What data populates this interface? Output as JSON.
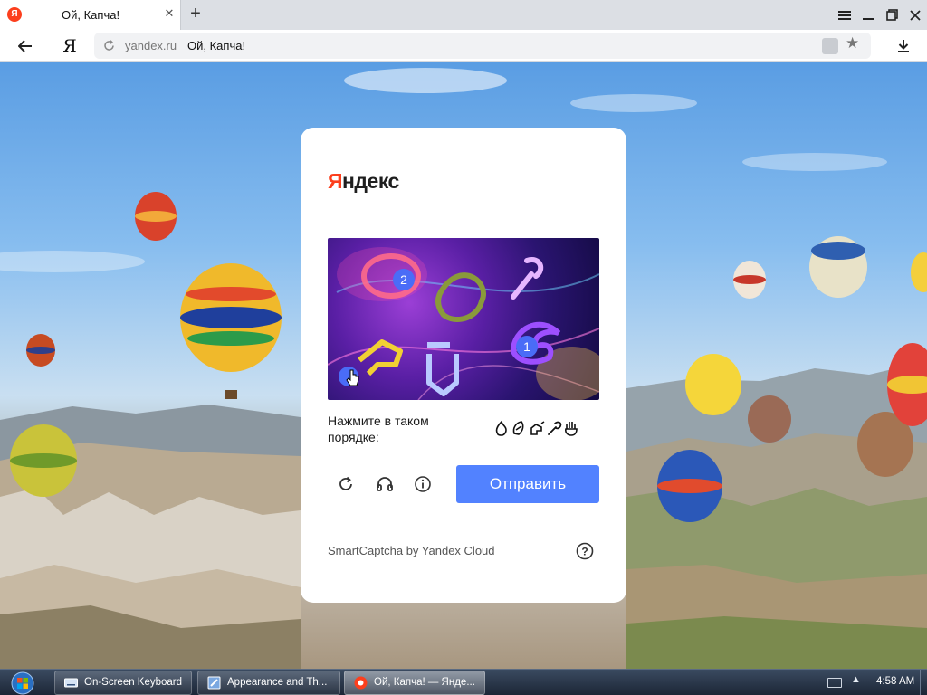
{
  "browser": {
    "tab_title": "Ой, Капча!",
    "tab_favicon_glyph": "Я",
    "new_tab_glyph": "+",
    "toolbar_logo": "Я",
    "address_domain": "yandex.ru",
    "address_title": "Ой, Капча!",
    "bookmark_glyph": "★",
    "tab_close_glyph": "✕"
  },
  "captcha": {
    "brand_first_letter": "Я",
    "brand_rest": "ндекс",
    "instruction": "Нажмите в таком порядке:",
    "marker_1": "1",
    "marker_2": "2",
    "submit_label": "Отправить",
    "footer": "SmartCaptcha by Yandex Cloud",
    "help_glyph": "?",
    "sequence_icons": [
      "flame-icon",
      "hand-leaf-icon",
      "hand-pointer-icon",
      "wrench-icon",
      "palm-icon"
    ]
  },
  "taskbar": {
    "items": [
      {
        "label": "On-Screen Keyboard"
      },
      {
        "label": "Appearance and Th..."
      },
      {
        "label": "Ой, Капча! — Янде..."
      }
    ],
    "clock": "4:58 AM",
    "tray_arrow": "▲"
  },
  "colors": {
    "brand_red": "#fc3f1d",
    "submit_blue": "#5282ff",
    "marker_blue": "#4a6cf7"
  }
}
